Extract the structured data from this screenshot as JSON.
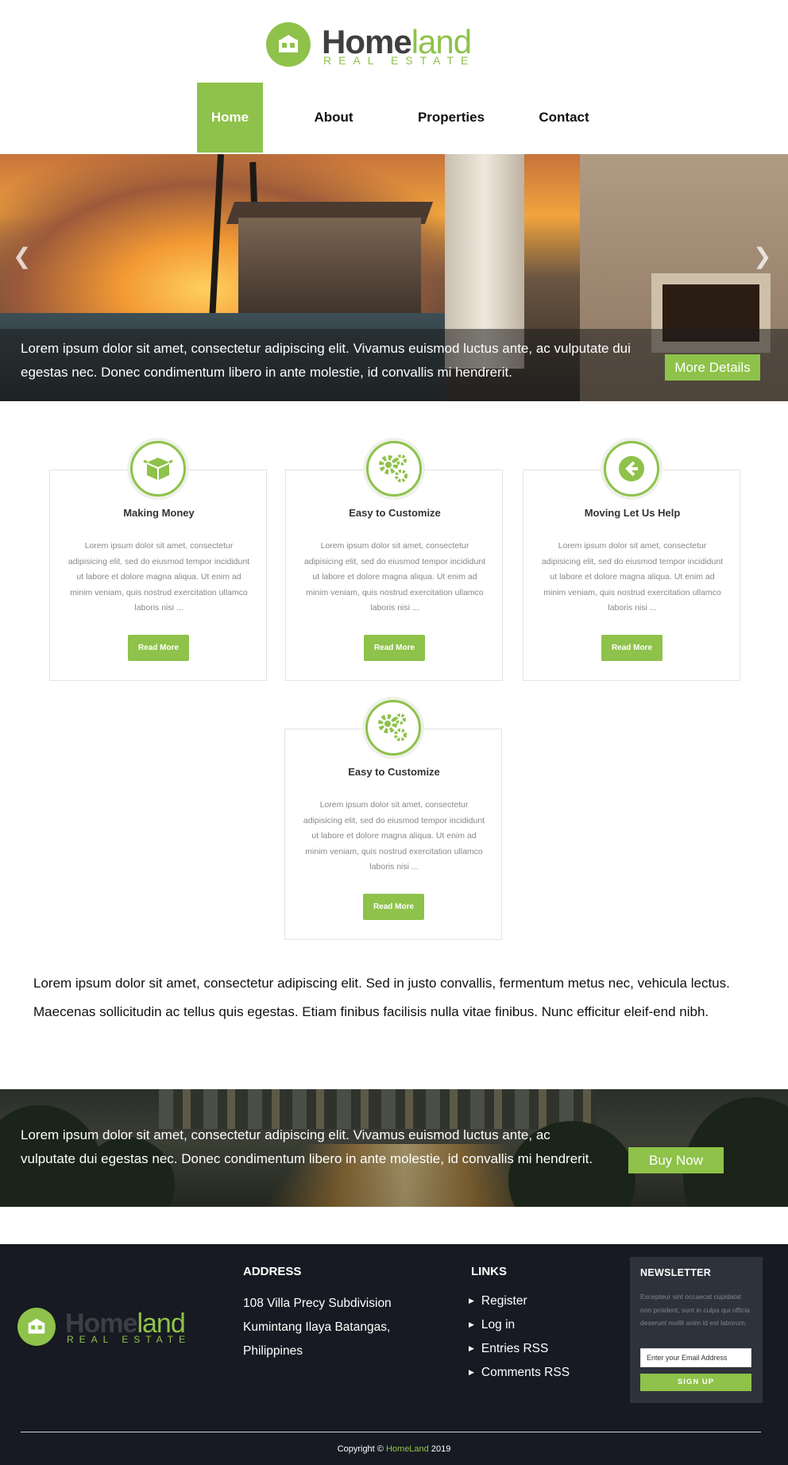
{
  "brand": {
    "word1": "Home",
    "word2": "land",
    "tagline": "REAL ESTATE",
    "accent": "#8ec24a",
    "icon": "house-icon"
  },
  "nav": {
    "items": [
      {
        "label": "Home",
        "active": true
      },
      {
        "label": "About",
        "active": false
      },
      {
        "label": "Properties",
        "active": false
      },
      {
        "label": "Contact",
        "active": false
      }
    ]
  },
  "hero": {
    "caption": "Lorem ipsum dolor sit amet, consectetur adipiscing elit. Vivamus euismod luctus ante, ac vulputate dui egestas nec. Donec condimentum libero in ante molestie, id convallis mi hendrerit.",
    "button": "More Details",
    "prev_icon": "chevron-left-icon",
    "next_icon": "chevron-right-icon"
  },
  "features": [
    {
      "icon": "box-icon",
      "title": "Making Money",
      "text": "Lorem ipsum dolor sit amet, consectetur adipisicing elit, sed do eiusmod tempor incididunt ut labore et dolore magna aliqua. Ut enim ad minim veniam, quis nostrud exercitation ullamco laboris nisi ...",
      "button": "Read More"
    },
    {
      "icon": "gears-icon",
      "title": "Easy to Customize",
      "text": "Lorem ipsum dolor sit amet, consectetur adipisicing elit, sed do eiusmod tempor incididunt ut labore et dolore magna aliqua. Ut enim ad minim veniam, quis nostrud exercitation ullamco laboris nisi ...",
      "button": "Read More"
    },
    {
      "icon": "arrow-circle-left-icon",
      "title": "Moving Let Us Help",
      "text": "Lorem ipsum dolor sit amet, consectetur adipisicing elit, sed do eiusmod tempor incididunt ut labore et dolore magna aliqua. Ut enim ad minim veniam, quis nostrud exercitation ullamco laboris nisi ...",
      "button": "Read More"
    },
    {
      "icon": "gears-icon",
      "title": "Easy to Customize",
      "text": "Lorem ipsum dolor sit amet, consectetur adipisicing elit, sed do eiusmod tempor incididunt ut labore et dolore magna aliqua. Ut enim ad minim veniam, quis nostrud exercitation ullamco laboris nisi ...",
      "button": "Read More"
    }
  ],
  "intro": "Lorem ipsum dolor sit amet, consectetur adipiscing elit. Sed in justo convallis, fermentum metus nec, vehicula lectus. Maecenas sollicitudin ac tellus quis egestas. Etiam finibus facilisis nulla vitae finibus. Nunc efficitur eleif-end nibh.",
  "banner": {
    "text": "Lorem ipsum dolor sit amet, consectetur adipiscing elit. Vivamus euismod luctus ante, ac vulputate dui egestas nec. Donec condimentum libero in ante molestie, id convallis mi hendrerit.",
    "button": "Buy Now"
  },
  "footer": {
    "address_heading": "ADDRESS",
    "address_lines": [
      "108 Villa Precy Subdivision",
      "Kumintang Ilaya Batangas,",
      "Philippines"
    ],
    "links_heading": "LINKS",
    "links": [
      "Register",
      "Log in",
      "Entries RSS",
      "Comments RSS"
    ],
    "newsletter": {
      "heading": "NEWSLETTER",
      "text": "Excepteur sint occaecat cupidatat non proident, sunt in culpa qui officia deserunt mollit anim id est laborum.",
      "placeholder": "Enter your Email Address",
      "button": "SIGN UP"
    },
    "copyright_prefix": "Copyright ©",
    "copyright_brand": "HomeLand",
    "copyright_year": "2019"
  }
}
